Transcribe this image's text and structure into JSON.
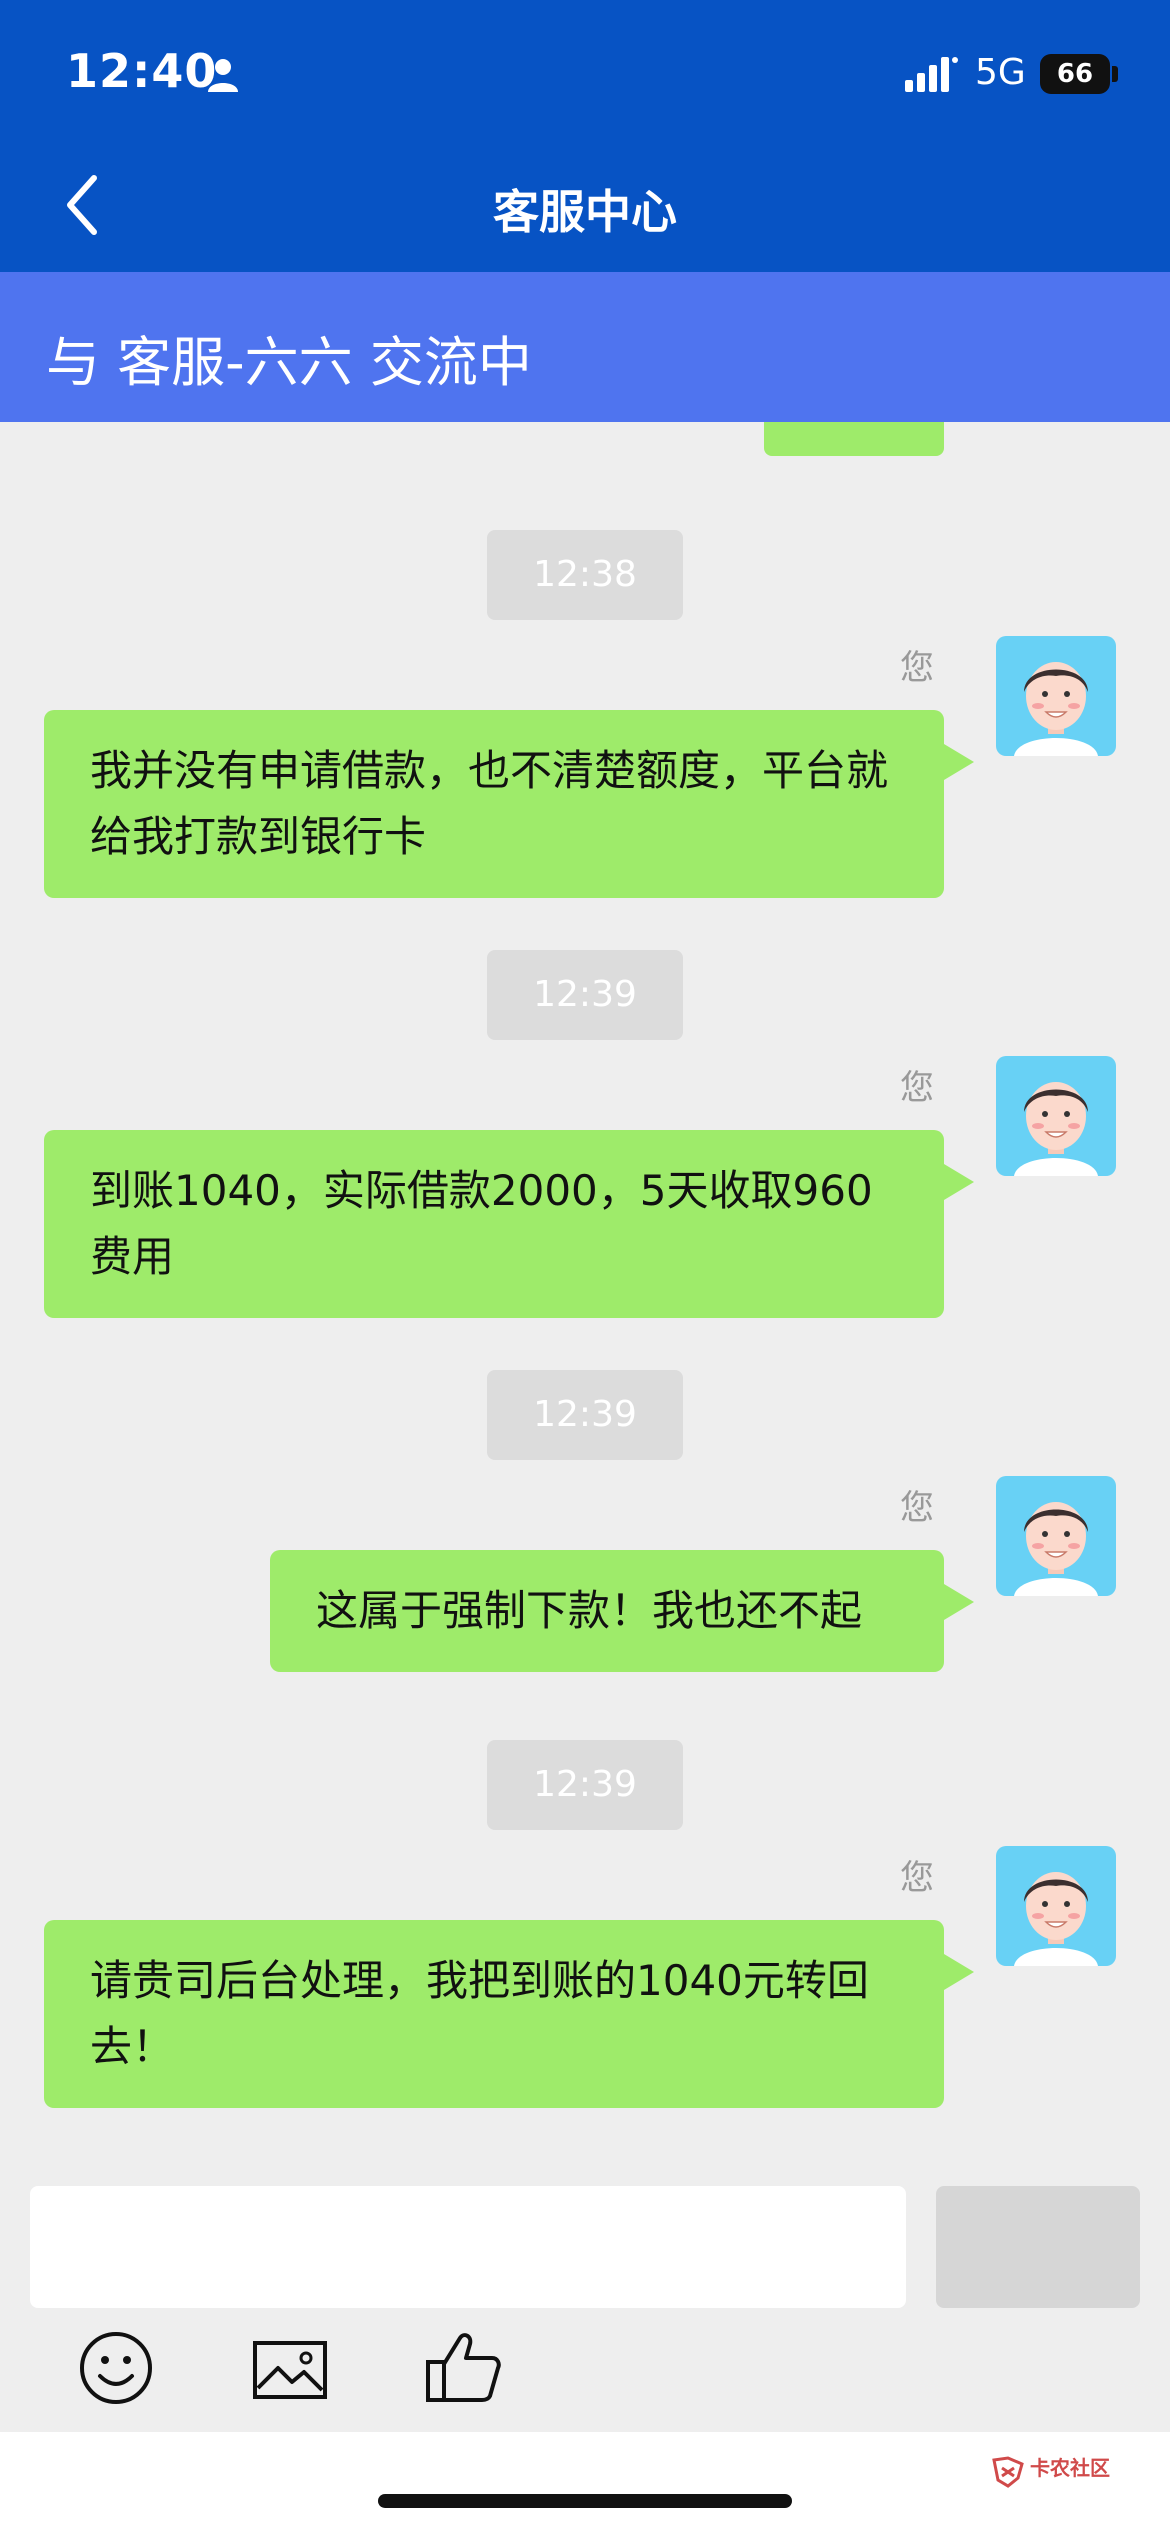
{
  "status_bar": {
    "time": "12:40",
    "network": "5G",
    "battery": "66"
  },
  "header": {
    "title": "客服中心"
  },
  "session": {
    "text": "与 客服-六六 交流中"
  },
  "messages": [
    {
      "time": "12:38",
      "sender": "您",
      "text": "我并没有申请借款，也不清楚额度，平台就给我打款到银行卡"
    },
    {
      "time": "12:39",
      "sender": "您",
      "text": "到账1040，实际借款2000，5天收取960费用"
    },
    {
      "time": "12:39",
      "sender": "您",
      "text": "这属于强制下款！我也还不起"
    },
    {
      "time": "12:39",
      "sender": "您",
      "text": "请贵司后台处理，我把到账的1040元转回去！"
    }
  ],
  "input": {
    "value": "",
    "placeholder": ""
  },
  "toolbar": {
    "icons": [
      "emoji-icon",
      "image-icon",
      "thumbs-up-icon"
    ]
  },
  "watermark": {
    "text": "卡农社区"
  },
  "colors": {
    "header": "#0753c4",
    "session_bar": "#4f74ef",
    "bubble": "#9eeb6a",
    "avatar_bg": "#68d1f5"
  }
}
